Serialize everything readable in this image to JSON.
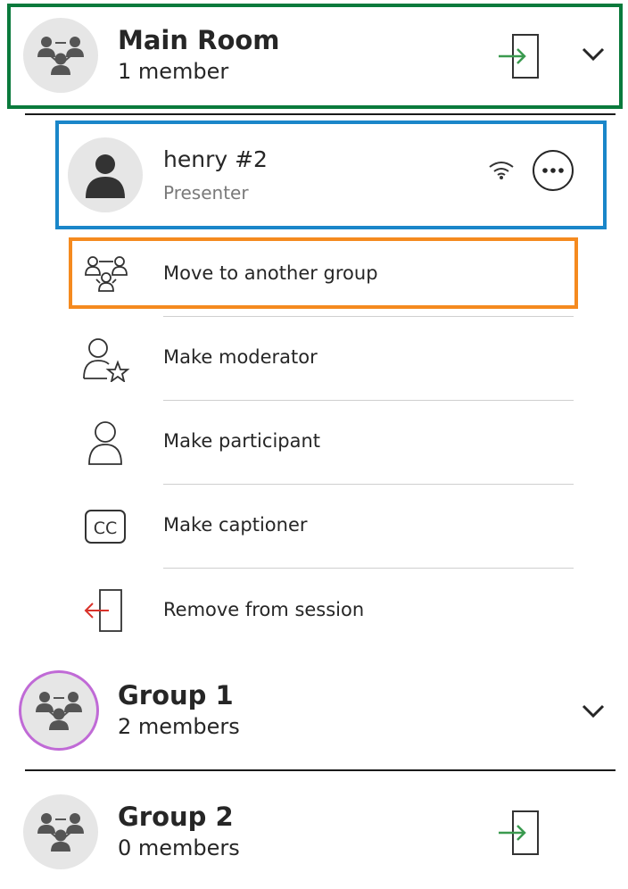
{
  "main_room": {
    "name": "Main Room",
    "members": "1 member"
  },
  "attendee": {
    "name": "henry #2",
    "role": "Presenter"
  },
  "menu": {
    "items": [
      {
        "label": "Move to another group",
        "icon": "group-move-icon"
      },
      {
        "label": "Make moderator",
        "icon": "user-star-icon"
      },
      {
        "label": "Make participant",
        "icon": "user-outline-icon"
      },
      {
        "label": "Make captioner",
        "icon": "closed-caption-icon"
      },
      {
        "label": "Remove from session",
        "icon": "exit-door-icon"
      }
    ]
  },
  "groups": [
    {
      "name": "Group 1",
      "members": "2 members"
    },
    {
      "name": "Group 2",
      "members": "0 members"
    }
  ],
  "colors": {
    "highlight_green": "#0a7a3c",
    "highlight_blue": "#1a86c9",
    "highlight_orange": "#f58a1f",
    "group1_ring": "#c06ad6",
    "join_arrow": "#3a9a4f",
    "remove_arrow": "#d9322a"
  }
}
